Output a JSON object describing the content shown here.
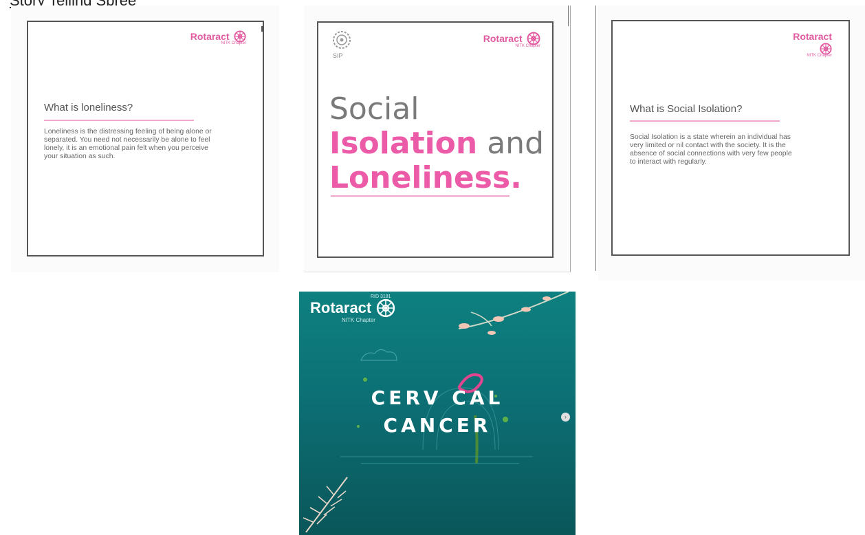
{
  "header": {
    "partial_link": "Story Telling Spree"
  },
  "logo": {
    "word": "Rotaract",
    "chapter": "NITK Chapter",
    "rid": "RID 3181"
  },
  "slides": [
    {
      "heading": "What is loneliness?",
      "body": [
        "Loneliness is the distressing feeling of being alone or",
        "separated. You need not necessarily be alone to feel",
        "lonely, it is an emotional pain felt when you perceive",
        "your situation as such."
      ]
    },
    {
      "sip_label": "SIP",
      "title_line1": "Social",
      "title_line2_pink": "Isolation",
      "title_line2_grey": " and",
      "title_line3_pink": "Loneliness."
    },
    {
      "heading": "What is Social Isolation?",
      "body": [
        "Social Isolation is a state wherein an individual has",
        "very limited or nil contact with the society. It is the",
        "absence of social connections with very few people",
        "to interact with regularly."
      ]
    }
  ],
  "poster": {
    "title_line1": "CERV CAL",
    "title_line2": "CANCER"
  },
  "carousel": {
    "next_icon": "chevron-right-icon",
    "next_glyph": "›"
  },
  "colors": {
    "pink": "#ec5ba8",
    "teal": "#0c6f74"
  }
}
